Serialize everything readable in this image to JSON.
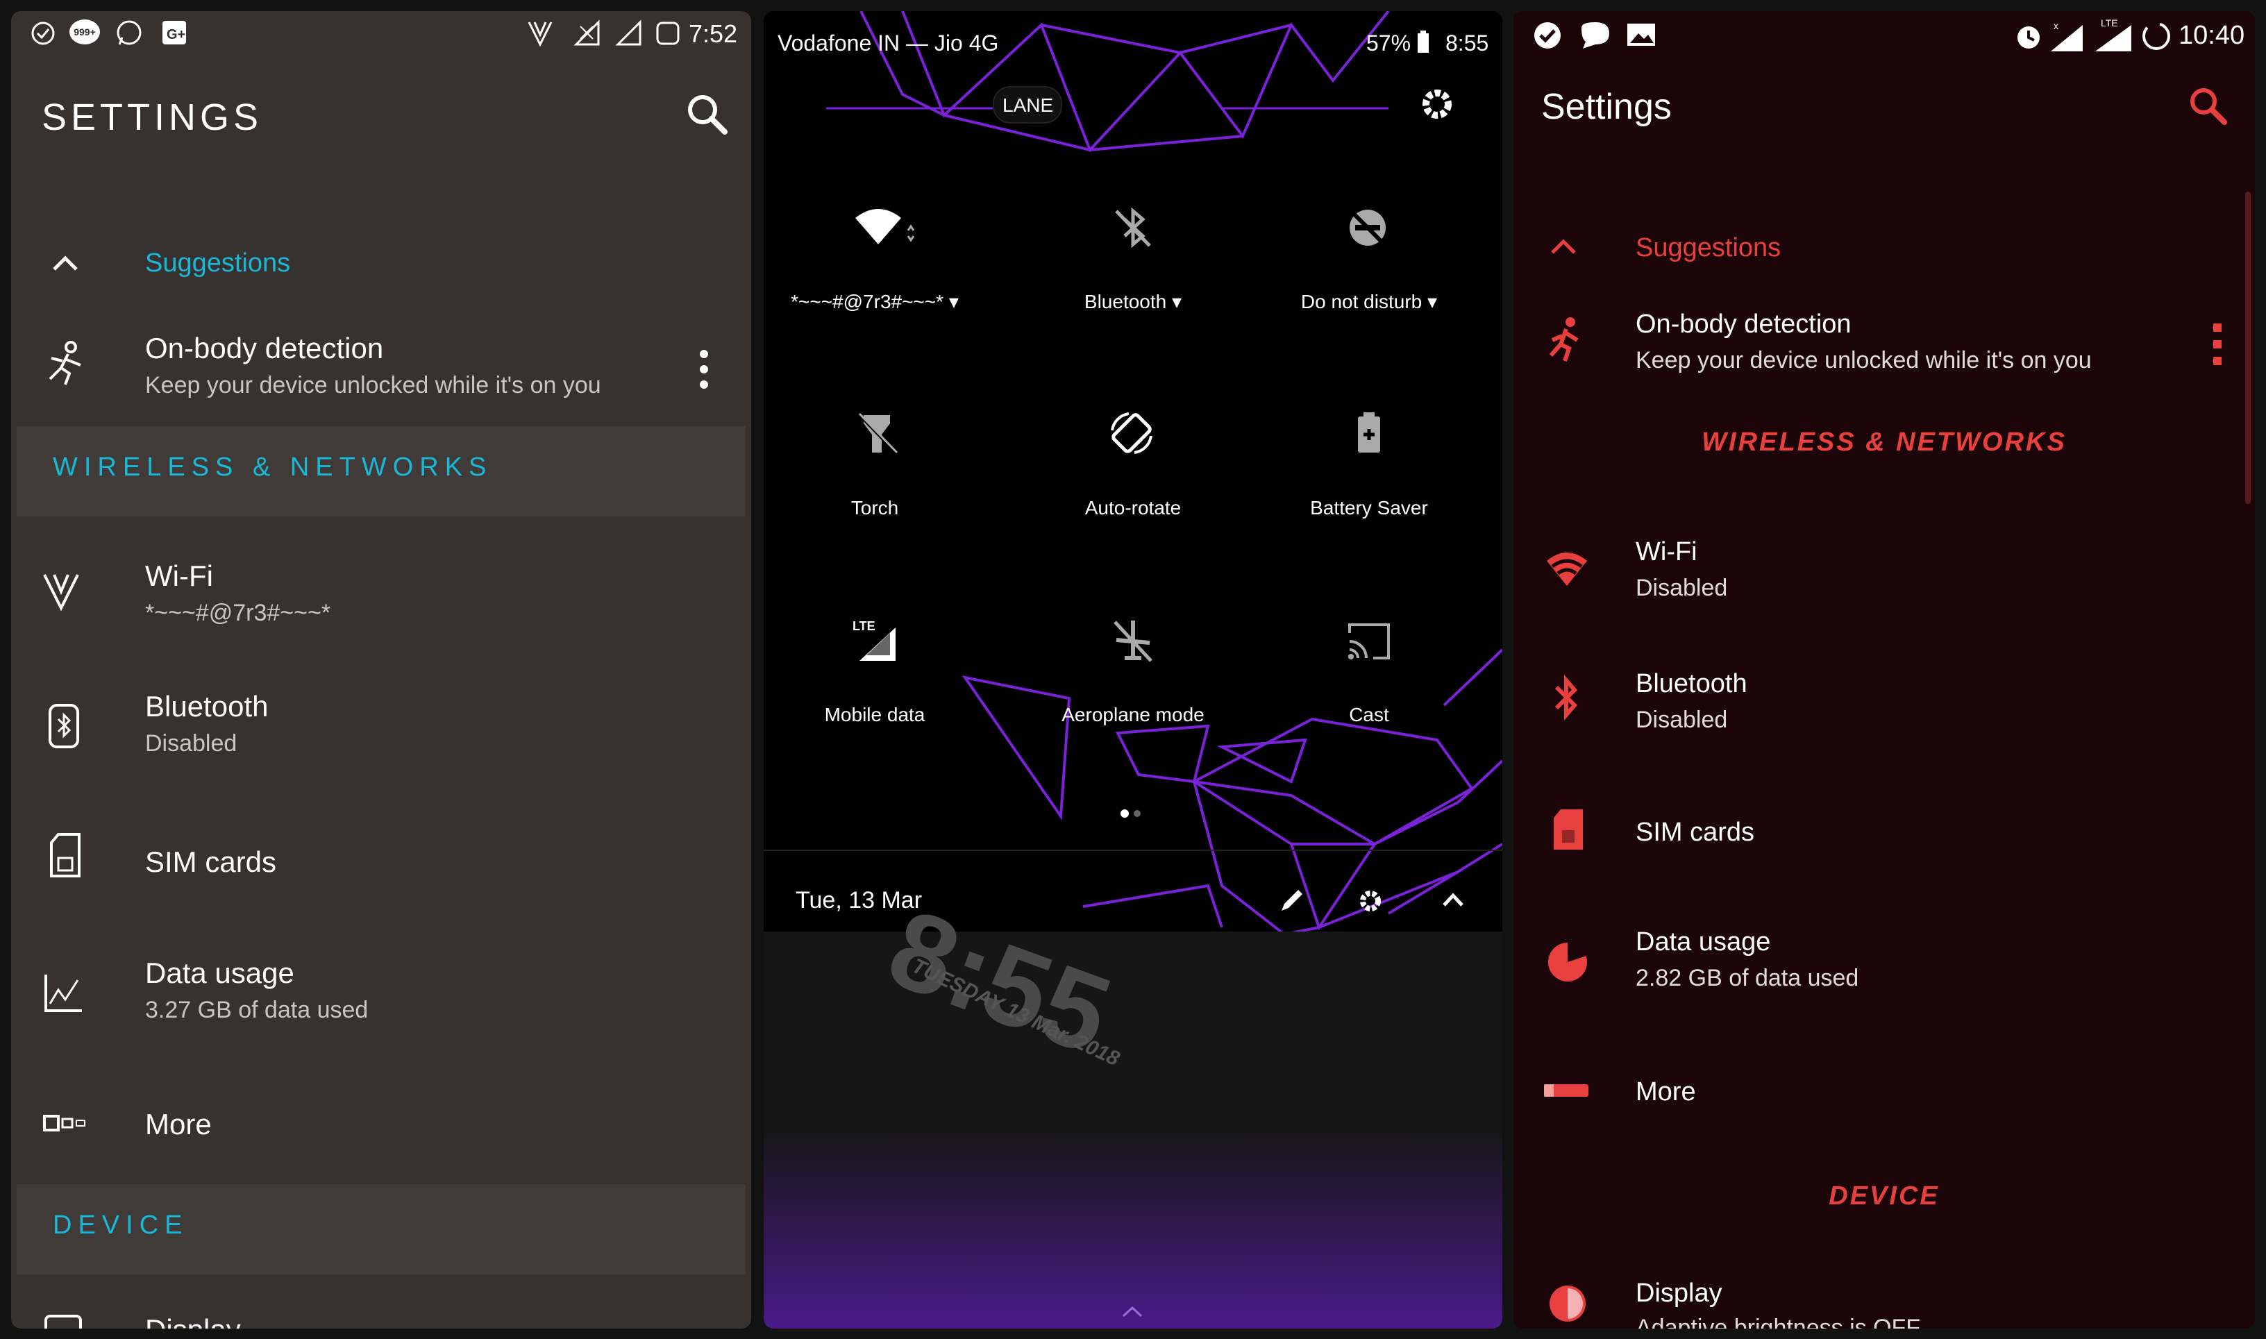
{
  "panel_left": {
    "status_time": "7:52",
    "notif_badge": "999+",
    "title": "SETTINGS",
    "suggestions_label": "Suggestions",
    "suggestion": {
      "title": "On-body detection",
      "subtitle": "Keep your device unlocked while it's on you"
    },
    "section_wireless": "WIRELESS & NETWORKS",
    "items": [
      {
        "label": "Wi-Fi",
        "sub": "*~~~#@7r3#~~~*"
      },
      {
        "label": "Bluetooth",
        "sub": "Disabled"
      },
      {
        "label": "SIM cards",
        "sub": ""
      },
      {
        "label": "Data usage",
        "sub": "3.27 GB of data used"
      },
      {
        "label": "More",
        "sub": ""
      }
    ],
    "section_device": "DEVICE",
    "device_item": "Display",
    "colors": {
      "background": "#37312f",
      "accent": "#18b8d6",
      "section_bg": "#403a38"
    }
  },
  "panel_middle": {
    "carrier": "Vodafone IN — Jio 4G",
    "battery": "57%",
    "time": "8:55",
    "lane_text": "LANE",
    "tiles": [
      {
        "label": "*~~~#@7r3#~~~*",
        "icon": "wifi-icon",
        "has_dropdown": true
      },
      {
        "label": "Bluetooth",
        "icon": "bluetooth-off-icon",
        "has_dropdown": true
      },
      {
        "label": "Do not disturb",
        "icon": "dnd-off-icon",
        "has_dropdown": true
      },
      {
        "label": "Torch",
        "icon": "torch-off-icon",
        "has_dropdown": false
      },
      {
        "label": "Auto-rotate",
        "icon": "auto-rotate-icon",
        "has_dropdown": false
      },
      {
        "label": "Battery Saver",
        "icon": "battery-saver-icon",
        "has_dropdown": false
      },
      {
        "label": "Mobile data",
        "icon": "mobile-data-icon",
        "has_dropdown": false
      },
      {
        "label": "Aeroplane mode",
        "icon": "airplane-off-icon",
        "has_dropdown": false
      },
      {
        "label": "Cast",
        "icon": "cast-icon",
        "has_dropdown": false
      }
    ],
    "date": "Tue, 13 Mar",
    "clock_big": "8:55",
    "clock_date": "TUESDAY 13 Mar. 2018",
    "colors": {
      "background": "#000000",
      "network_lines": "#7a22d8",
      "gradient_bottom": "#4a1a8a"
    }
  },
  "panel_right": {
    "status_time": "10:40",
    "title": "Settings",
    "suggestions_label": "Suggestions",
    "suggestion": {
      "title": "On-body detection",
      "subtitle": "Keep your device unlocked while it's on you"
    },
    "section_wireless": "WIRELESS & NETWORKS",
    "items": [
      {
        "label": "Wi-Fi",
        "sub": "Disabled"
      },
      {
        "label": "Bluetooth",
        "sub": "Disabled"
      },
      {
        "label": "SIM cards",
        "sub": ""
      },
      {
        "label": "Data usage",
        "sub": "2.82 GB of data used"
      },
      {
        "label": "More",
        "sub": ""
      }
    ],
    "section_device": "DEVICE",
    "device_item": {
      "label": "Display",
      "sub": "Adaptive brightness is OFF"
    },
    "colors": {
      "background": "#1c0508",
      "accent": "#e8403f"
    }
  }
}
